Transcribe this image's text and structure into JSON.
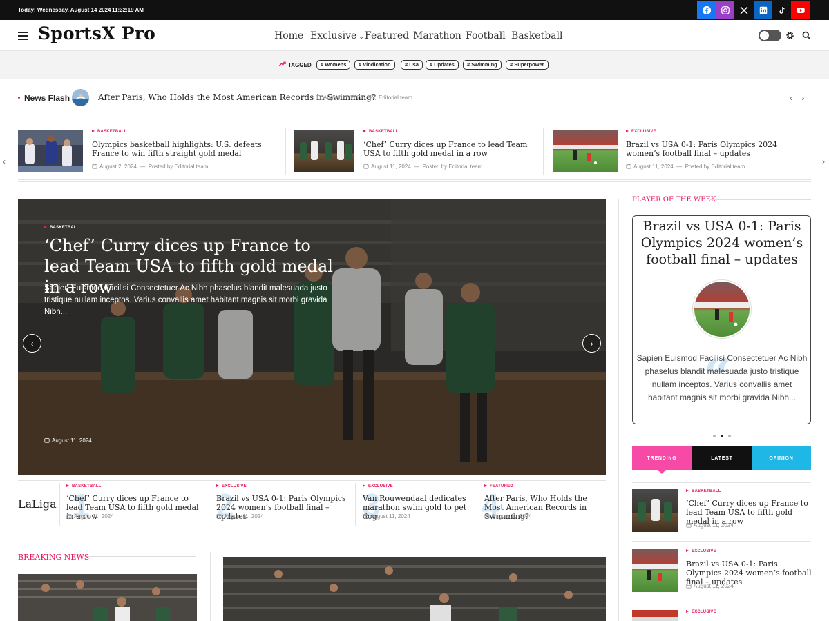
{
  "topbar": {
    "date": "Today: Wednesday, August 14 2024",
    "time": "11:32:19 AM",
    "social": [
      {
        "icon": "facebook-icon",
        "color": "#1877f2"
      },
      {
        "icon": "instagram-icon",
        "color": "#9b3fc7"
      },
      {
        "icon": "x-icon",
        "color": "#111111"
      },
      {
        "icon": "linkedin-icon",
        "color": "#0a66c2"
      },
      {
        "icon": "tiktok-icon",
        "color": "#111111"
      },
      {
        "icon": "youtube-icon",
        "color": "#ff0000"
      }
    ]
  },
  "header": {
    "logo": "SportsX Pro",
    "nav": [
      "Home",
      "Exclusive",
      "Featured",
      "Marathon",
      "Football",
      "Basketball"
    ]
  },
  "tags": {
    "label": "TAGGED",
    "items": [
      "# Womens",
      "# Vindication",
      "# Usa",
      "# Updates",
      "# Swimming",
      "# Superpower"
    ]
  },
  "newsflash": {
    "label": "News Flash",
    "title": "After Paris, Who Holds the Most American Records in Swimming?",
    "date": "August 11, 2024",
    "author": "Editorial team"
  },
  "carousel": [
    {
      "category": "BASKETBALL",
      "title": "Olympics basketball highlights: U.S. defeats France to win fifth straight gold medal",
      "date": "August 2, 2024",
      "posted": "Posted by",
      "author": "Editorial team"
    },
    {
      "category": "BASKETBALL",
      "title": "‘Chef’ Curry dices up France to lead Team USA to fifth gold medal in a row",
      "date": "August 11, 2024",
      "posted": "Posted by",
      "author": "Editorial team"
    },
    {
      "category": "EXCLUSIVE",
      "title": "Brazil vs USA 0-1: Paris Olympics 2024 women’s football final – updates",
      "date": "August 11, 2024",
      "posted": "Posted by",
      "author": "Editorial team"
    }
  ],
  "hero": {
    "category": "BASKETBALL",
    "title": "‘Chef’ Curry dices up France to lead Team USA to fifth gold medal in a row",
    "excerpt": "Sapien Euismod Facilisi Consectetuer Ac Nibh phaselus blandit malesuada justo tristique nullam inceptos. Varius convallis amet habitant magnis sit morbi gravida Nibh...",
    "date": "August 11, 2024"
  },
  "bottom": {
    "label": "LaLiga",
    "posts": [
      {
        "num": "1",
        "category": "BASKETBALL",
        "title": "‘Chef’ Curry dices up France to lead Team USA to fifth gold medal in a row",
        "date": "August 11, 2024"
      },
      {
        "num": "2",
        "category": "EXCLUSIVE",
        "title": "Brazil vs USA 0-1: Paris Olympics 2024 women’s football final – updates",
        "date": "August 11, 2024"
      },
      {
        "num": "3",
        "category": "EXCLUSIVE",
        "title": "Van Rouwendaal dedicates marathon swim gold to pet dog",
        "date": "August 11, 2024"
      },
      {
        "num": "4",
        "category": "FEATURED",
        "title": "After Paris, Who Holds the Most American Records in Swimming?",
        "date": "August 11, 2024"
      }
    ]
  },
  "breaking": {
    "label": "BREAKING NEWS"
  },
  "sidebar": {
    "potw_label": "PLAYER OF THE WEEK",
    "potw_title": "Brazil vs USA 0-1: Paris Olympics 2024 women’s football final – updates",
    "potw_excerpt": "Sapien Euismod Facilisi Consectetuer Ac Nibh phaselus blandit malesuada justo tristique nullam inceptos. Varius convallis amet habitant magnis sit morbi gravida Nibh...",
    "tabs": [
      {
        "label": "TRENDING",
        "color": "#f74aa6"
      },
      {
        "label": "LATEST",
        "color": "#111111"
      },
      {
        "label": "OPINION",
        "color": "#1fb8e6"
      }
    ],
    "posts": [
      {
        "category": "BASKETBALL",
        "title": "‘Chef’ Curry dices up France to lead Team USA to fifth gold medal in a row",
        "date": "August 11, 2024"
      },
      {
        "category": "EXCLUSIVE",
        "title": "Brazil vs USA 0-1: Paris Olympics 2024 women’s football final – updates",
        "date": "August 11, 2024"
      },
      {
        "category": "EXCLUSIVE",
        "title": "",
        "date": ""
      }
    ]
  },
  "colors": {
    "accent": "#e8185a",
    "dark": "#111111"
  }
}
